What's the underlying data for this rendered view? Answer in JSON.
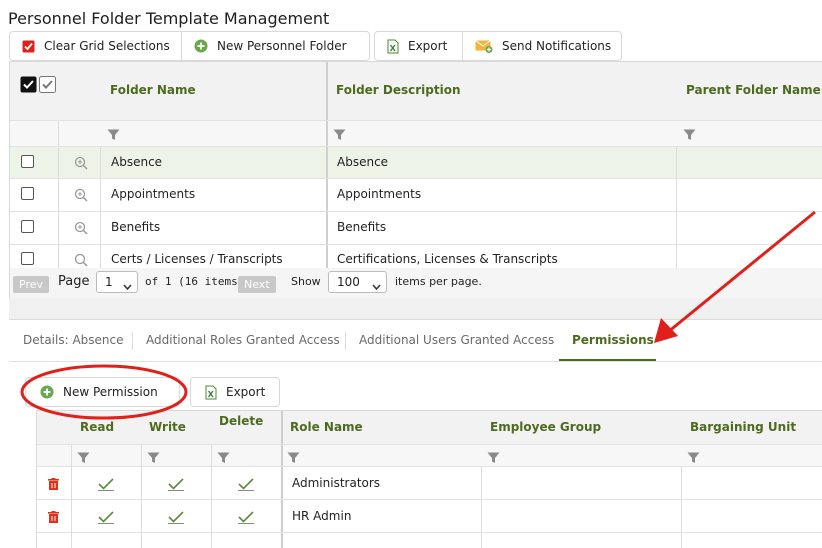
{
  "page": {
    "title": "Personnel Folder Template Management"
  },
  "toolbar": {
    "clear": "Clear Grid Selections",
    "new_folder": "New Personnel Folder",
    "export": "Export",
    "notify": "Send Notifications"
  },
  "folders": {
    "headers": {
      "name": "Folder Name",
      "description": "Folder Description",
      "parent": "Parent Folder Name"
    },
    "rows": [
      {
        "name": "Absence",
        "description": "Absence"
      },
      {
        "name": "Appointments",
        "description": "Appointments"
      },
      {
        "name": "Benefits",
        "description": "Benefits"
      },
      {
        "name": "Certs / Licenses / Transcripts",
        "description": "Certifications, Licenses & Transcripts"
      }
    ]
  },
  "pager": {
    "prev": "Prev",
    "page_label": "Page",
    "page_value": "1",
    "of_text": "of 1 (16 items)",
    "next": "Next",
    "show_label": "Show",
    "per_page_value": "100",
    "per_page_suffix": "items per page."
  },
  "tabs": {
    "details": "Details: Absence",
    "roles": "Additional Roles Granted Access",
    "users": "Additional Users Granted Access",
    "permissions": "Permissions"
  },
  "perm_toolbar": {
    "new_permission": "New Permission",
    "export": "Export"
  },
  "permissions": {
    "headers": {
      "read": "Read",
      "write": "Write",
      "delete": "Delete",
      "role": "Role Name",
      "employee_group": "Employee Group",
      "bargaining_unit": "Bargaining Unit"
    },
    "rows": [
      {
        "role": "Administrators"
      },
      {
        "role": "HR Admin"
      }
    ]
  },
  "colors": {
    "accent": "#4d6b1f",
    "annotation": "#e0201b"
  }
}
